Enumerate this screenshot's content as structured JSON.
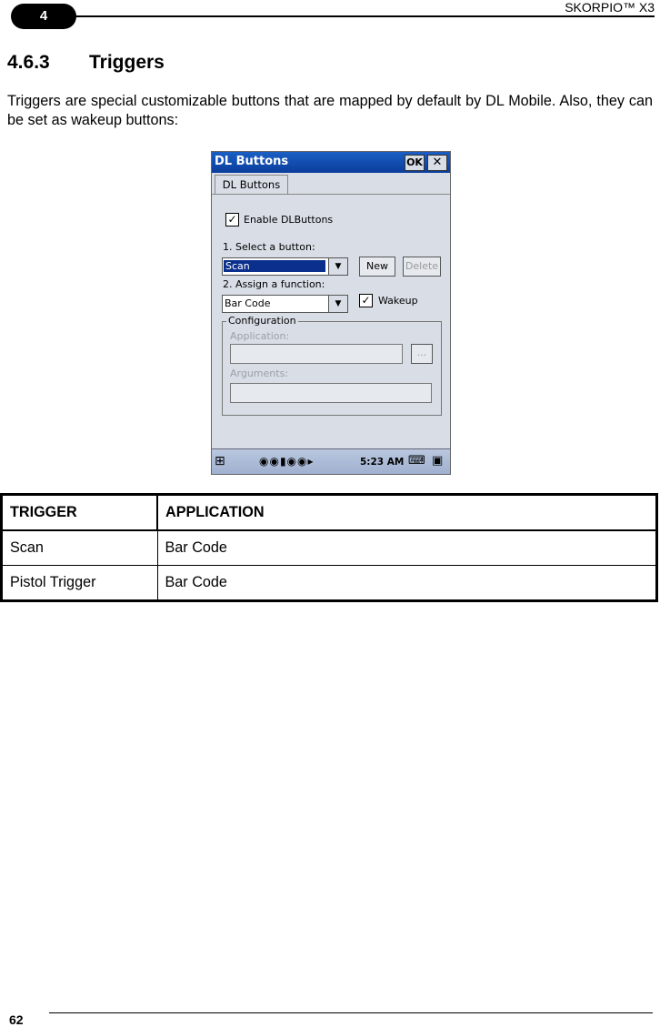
{
  "header": {
    "chapter": "4",
    "doc_title": "SKORPIO™ X3"
  },
  "section": {
    "number": "4.6.3",
    "title": "Triggers",
    "paragraph": "Triggers are special customizable buttons that are mapped by default by DL Mobile. Also, they can be set as wakeup buttons:"
  },
  "screenshot": {
    "window_title": "DL Buttons",
    "ok_label": "OK",
    "close_label": "✕",
    "tab_label": "DL Buttons",
    "enable_label": "Enable DLButtons",
    "select_label": "1. Select a button:",
    "select_value": "Scan",
    "new_label": "New",
    "delete_label": "Delete",
    "assign_label": "2. Assign a function:",
    "assign_value": "Bar Code",
    "wakeup_label": "Wakeup",
    "config_label": "Configuration",
    "application_label": "Application:",
    "browse_label": "...",
    "arguments_label": "Arguments:",
    "time": "5:23 AM",
    "colors": {
      "titlebar": "#0b3d9c",
      "selection": "#0b2f8c",
      "background": "#d8dde6"
    }
  },
  "table": {
    "headers": [
      "TRIGGER",
      "APPLICATION"
    ],
    "rows": [
      [
        "Scan",
        "Bar Code"
      ],
      [
        "Pistol Trigger",
        "Bar Code"
      ]
    ]
  },
  "footer": {
    "page_number": "62"
  }
}
